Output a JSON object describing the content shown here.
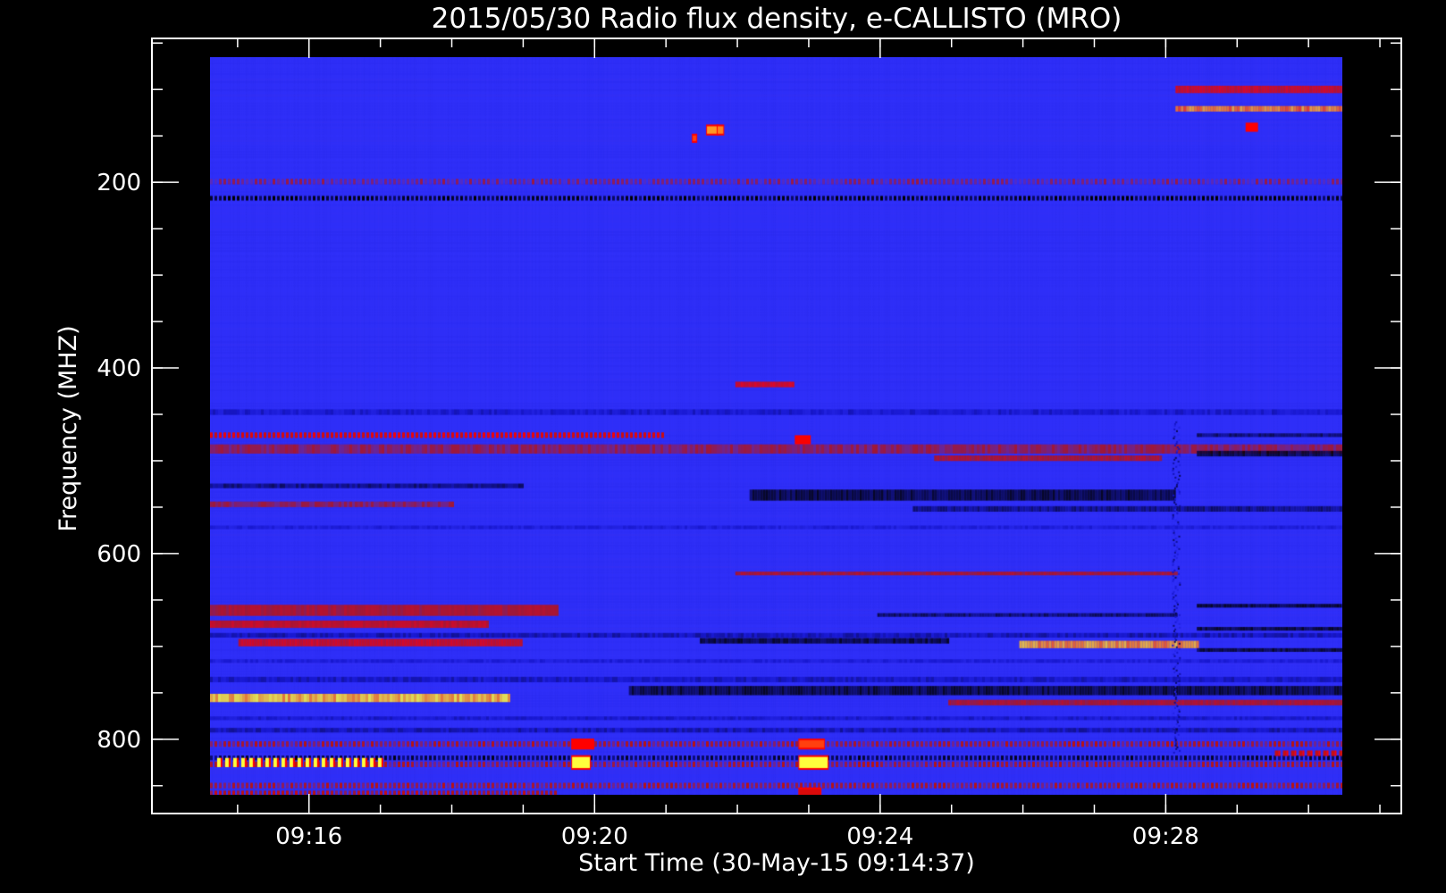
{
  "chart_data": {
    "type": "heatmap",
    "title": "2015/05/30  Radio flux density, e-CALLISTO (MRO)",
    "xlabel": "Start Time (30-May-15 09:14:37)",
    "ylabel": "Frequency (MHZ)",
    "x_unit": "minutes after 09:00 UT",
    "xlim": [
      13.8,
      31.3
    ],
    "ylim": [
      45,
      880
    ],
    "data_xlim": [
      14.6,
      30.55
    ],
    "data_ylim": [
      45,
      845
    ],
    "y_inverted": true,
    "x_ticks": [
      {
        "value": 16,
        "label": "09:16"
      },
      {
        "value": 20,
        "label": "09:20"
      },
      {
        "value": 24,
        "label": "09:24"
      },
      {
        "value": 28,
        "label": "09:28"
      }
    ],
    "x_minor_step": 1,
    "y_ticks": [
      {
        "value": 200,
        "label": "200"
      },
      {
        "value": 400,
        "label": "400"
      },
      {
        "value": 600,
        "label": "600"
      },
      {
        "value": 800,
        "label": "800"
      }
    ],
    "y_minor_step": 50,
    "colormap": [
      "#000000",
      "#1414c8",
      "#3232ff",
      "#b41414",
      "#ff0000",
      "#ffff3c"
    ],
    "background_level": 0.37,
    "bands": [
      {
        "f": 80,
        "w": 8,
        "t0": 28.2,
        "t1": 30.55,
        "level": 0.72
      },
      {
        "f": 101,
        "w": 6,
        "t0": 28.2,
        "t1": 30.55,
        "level": 0.9
      },
      {
        "f": 198,
        "w": 5,
        "t0": 14.6,
        "t1": 30.55,
        "level": 0.05,
        "dashed": true
      },
      {
        "f": 180,
        "w": 6,
        "t0": 14.6,
        "t1": 30.55,
        "level": 0.5,
        "dashed": true
      },
      {
        "f": 400,
        "w": 6,
        "t0": 22.0,
        "t1": 22.8,
        "level": 0.75
      },
      {
        "f": 430,
        "w": 6,
        "t0": 14.6,
        "t1": 30.55,
        "level": 0.22
      },
      {
        "f": 455,
        "w": 6,
        "t0": 14.6,
        "t1": 21.0,
        "level": 0.72,
        "dashed": true
      },
      {
        "f": 470,
        "w": 10,
        "t0": 14.6,
        "t1": 30.55,
        "level": 0.55
      },
      {
        "f": 475,
        "w": 6,
        "t0": 28.5,
        "t1": 30.55,
        "level": 0.05
      },
      {
        "f": 455,
        "w": 4,
        "t0": 28.5,
        "t1": 30.55,
        "level": 0.1
      },
      {
        "f": 480,
        "w": 6,
        "t0": 24.8,
        "t1": 28.0,
        "level": 0.62
      },
      {
        "f": 510,
        "w": 5,
        "t0": 14.6,
        "t1": 19.0,
        "level": 0.12
      },
      {
        "f": 520,
        "w": 12,
        "t0": 22.2,
        "t1": 28.2,
        "level": 0.05
      },
      {
        "f": 530,
        "w": 6,
        "t0": 14.6,
        "t1": 18.0,
        "level": 0.55
      },
      {
        "f": 535,
        "w": 6,
        "t0": 24.5,
        "t1": 30.55,
        "level": 0.12
      },
      {
        "f": 555,
        "w": 4,
        "t0": 14.6,
        "t1": 30.55,
        "level": 0.25
      },
      {
        "f": 605,
        "w": 4,
        "t0": 22.0,
        "t1": 28.2,
        "level": 0.62
      },
      {
        "f": 640,
        "w": 4,
        "t0": 28.5,
        "t1": 30.55,
        "level": 0.05
      },
      {
        "f": 645,
        "w": 12,
        "t0": 14.6,
        "t1": 19.5,
        "level": 0.62
      },
      {
        "f": 650,
        "w": 4,
        "t0": 24.0,
        "t1": 28.2,
        "level": 0.1
      },
      {
        "f": 660,
        "w": 8,
        "t0": 14.6,
        "t1": 18.5,
        "level": 0.68
      },
      {
        "f": 665,
        "w": 4,
        "t0": 28.5,
        "t1": 30.55,
        "level": 0.05
      },
      {
        "f": 672,
        "w": 5,
        "t0": 14.6,
        "t1": 30.55,
        "level": 0.18
      },
      {
        "f": 680,
        "w": 8,
        "t0": 15.0,
        "t1": 19.0,
        "level": 0.72
      },
      {
        "f": 678,
        "w": 6,
        "t0": 21.5,
        "t1": 25.0,
        "level": 0.05
      },
      {
        "f": 682,
        "w": 8,
        "t0": 26.0,
        "t1": 28.5,
        "level": 0.92
      },
      {
        "f": 688,
        "w": 4,
        "t0": 28.5,
        "t1": 30.55,
        "level": 0.05
      },
      {
        "f": 700,
        "w": 4,
        "t0": 14.6,
        "t1": 30.55,
        "level": 0.25
      },
      {
        "f": 720,
        "w": 6,
        "t0": 14.6,
        "t1": 30.55,
        "level": 0.2
      },
      {
        "f": 732,
        "w": 10,
        "t0": 20.5,
        "t1": 30.55,
        "level": 0.05
      },
      {
        "f": 740,
        "w": 9,
        "t0": 14.6,
        "t1": 18.8,
        "level": 0.95
      },
      {
        "f": 745,
        "w": 6,
        "t0": 25.0,
        "t1": 30.55,
        "level": 0.62
      },
      {
        "f": 762,
        "w": 4,
        "t0": 14.6,
        "t1": 30.55,
        "level": 0.22
      },
      {
        "f": 775,
        "w": 5,
        "t0": 14.6,
        "t1": 30.55,
        "level": 0.18
      },
      {
        "f": 790,
        "w": 6,
        "t0": 14.6,
        "t1": 30.55,
        "level": 0.55,
        "dashed": true
      },
      {
        "f": 805,
        "w": 5,
        "t0": 14.6,
        "t1": 30.55,
        "level": 0.08,
        "dashed": true
      },
      {
        "f": 812,
        "w": 6,
        "t0": 14.6,
        "t1": 30.55,
        "level": 0.55,
        "dashed": true
      },
      {
        "f": 835,
        "w": 6,
        "t0": 14.6,
        "t1": 30.55,
        "level": 0.55,
        "dashed": true
      },
      {
        "f": 843,
        "w": 5,
        "t0": 14.6,
        "t1": 19.5,
        "level": 0.6,
        "dashed": true
      }
    ],
    "bursts": [
      {
        "t": 14.7,
        "f": 810,
        "dt": 2.3,
        "df": 10,
        "level": 1.0,
        "dashed": true
      },
      {
        "t": 19.7,
        "f": 810,
        "dt": 0.25,
        "df": 12,
        "level": 1.0
      },
      {
        "t": 22.9,
        "f": 810,
        "dt": 0.4,
        "df": 12,
        "level": 1.0
      },
      {
        "t": 22.9,
        "f": 790,
        "dt": 0.35,
        "df": 8,
        "level": 0.85
      },
      {
        "t": 22.9,
        "f": 842,
        "dt": 0.3,
        "df": 6,
        "level": 0.7
      },
      {
        "t": 19.7,
        "f": 790,
        "dt": 0.3,
        "df": 8,
        "level": 0.8
      },
      {
        "t": 21.6,
        "f": 124,
        "dt": 0.15,
        "df": 8,
        "level": 0.92
      },
      {
        "t": 21.75,
        "f": 124,
        "dt": 0.08,
        "df": 8,
        "level": 0.9
      },
      {
        "t": 21.4,
        "f": 133,
        "dt": 0.05,
        "df": 6,
        "level": 0.85
      },
      {
        "t": 22.85,
        "f": 460,
        "dt": 0.2,
        "df": 6,
        "level": 0.78
      },
      {
        "t": 29.2,
        "f": 121,
        "dt": 0.15,
        "df": 6,
        "level": 0.8
      },
      {
        "t": 29.6,
        "f": 800,
        "dt": 0.95,
        "df": 6,
        "level": 0.65,
        "dashed": true
      }
    ]
  }
}
